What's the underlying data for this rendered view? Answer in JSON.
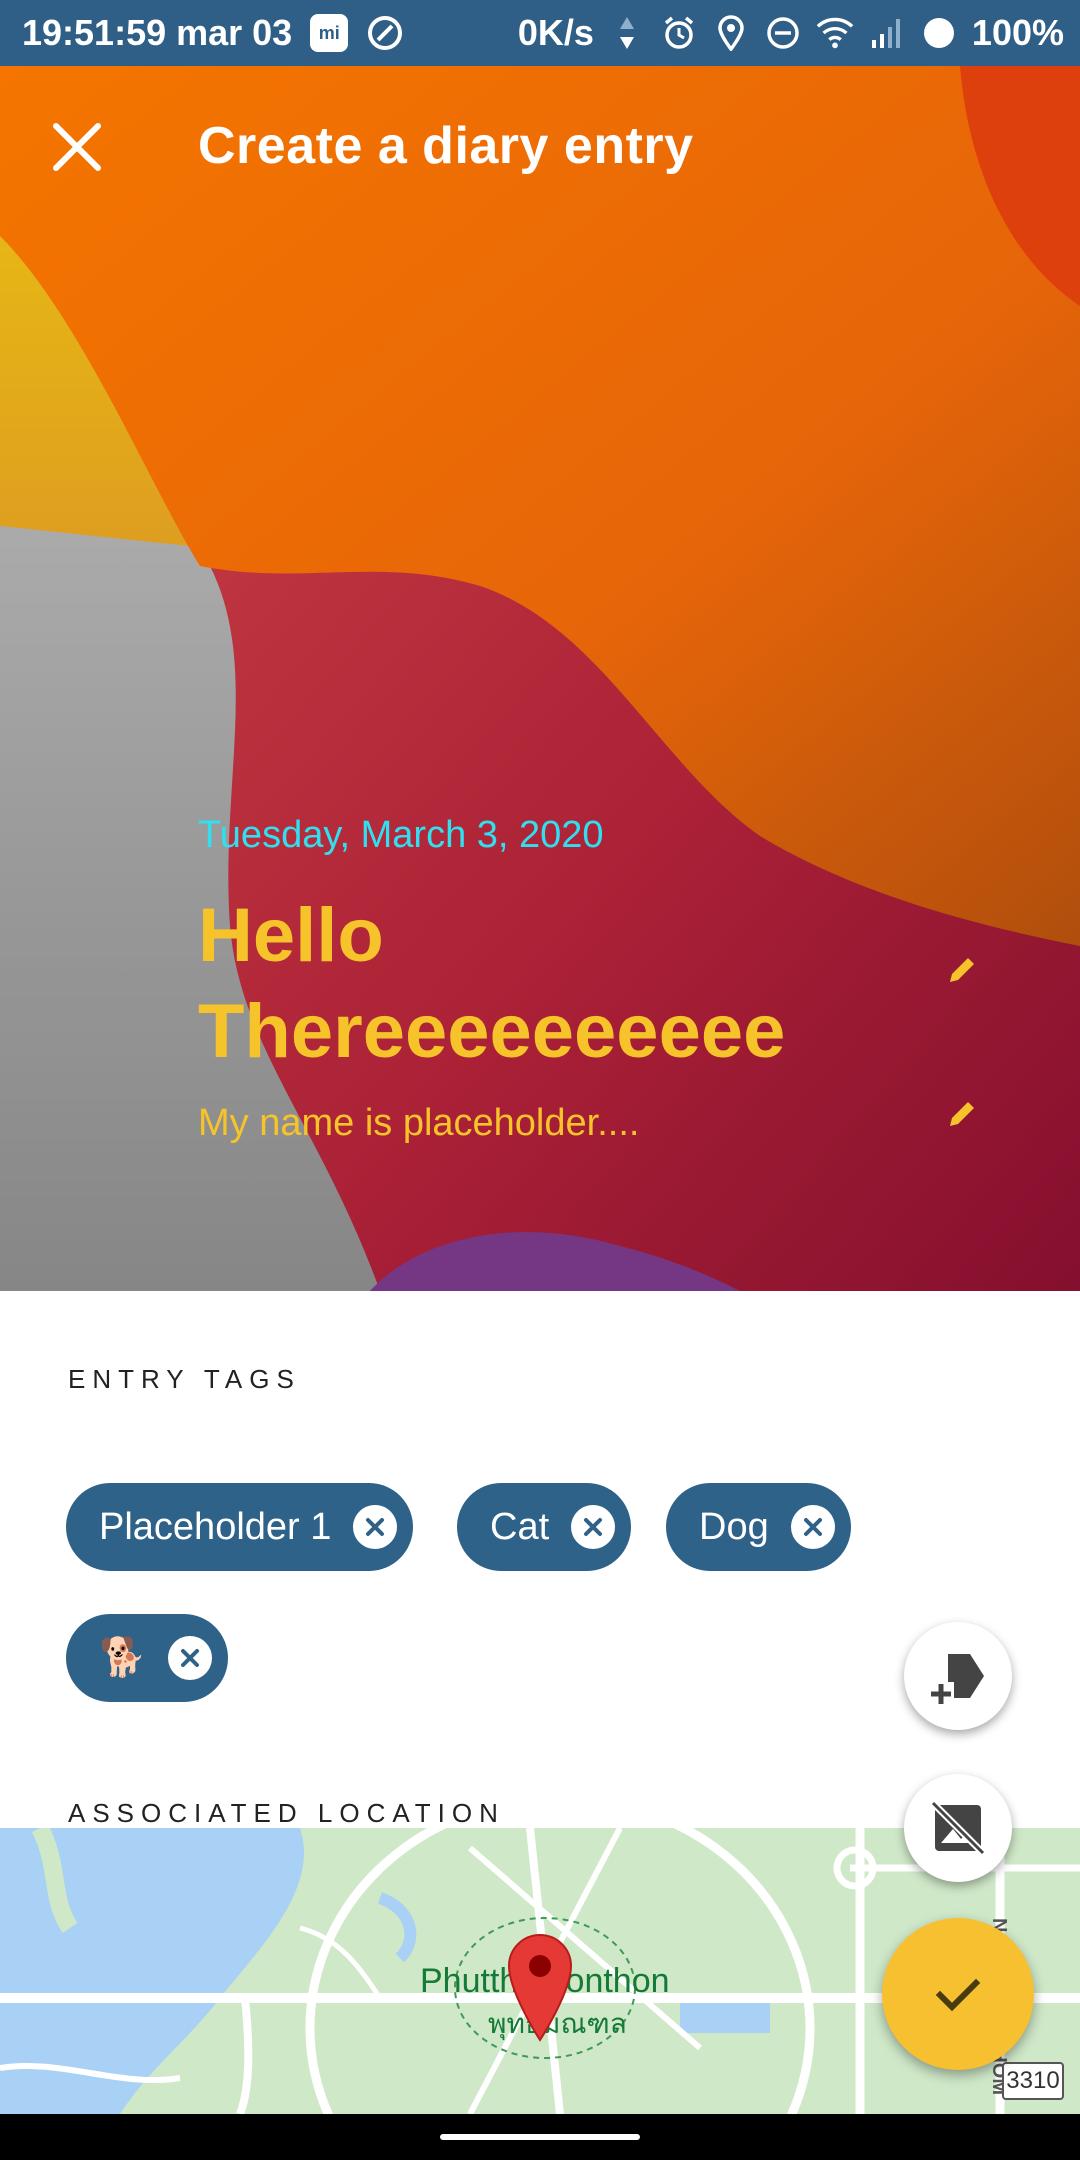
{
  "status_bar": {
    "time": "19:51:59 mar 03",
    "net_speed": "0K/s",
    "battery": "100%"
  },
  "app_bar": {
    "title": "Create a diary entry",
    "close_icon": "close-icon"
  },
  "entry": {
    "date": "Tuesday, March 3, 2020",
    "title": "Hello Thereeeeeeeeee",
    "body": "My name is placeholder...."
  },
  "tags_section": {
    "label": "ENTRY TAGS",
    "tags": [
      "Placeholder 1",
      "Cat",
      "Dog",
      "🐕"
    ]
  },
  "location_section": {
    "label": "ASSOCIATED LOCATION",
    "map_place_en": "Phutthamonthon",
    "map_place_th": "พุทธมณฑล",
    "map_region": "NAKHON PATHOM",
    "map_road": "3310"
  },
  "fabs": {
    "add_tag": "tag-add-icon",
    "remove_image": "image-off-icon",
    "save": "check-icon"
  },
  "colors": {
    "primary": "#2f6289",
    "accent": "#f6c031",
    "date_color": "#30e0f0",
    "title_color": "#f6c42a"
  }
}
